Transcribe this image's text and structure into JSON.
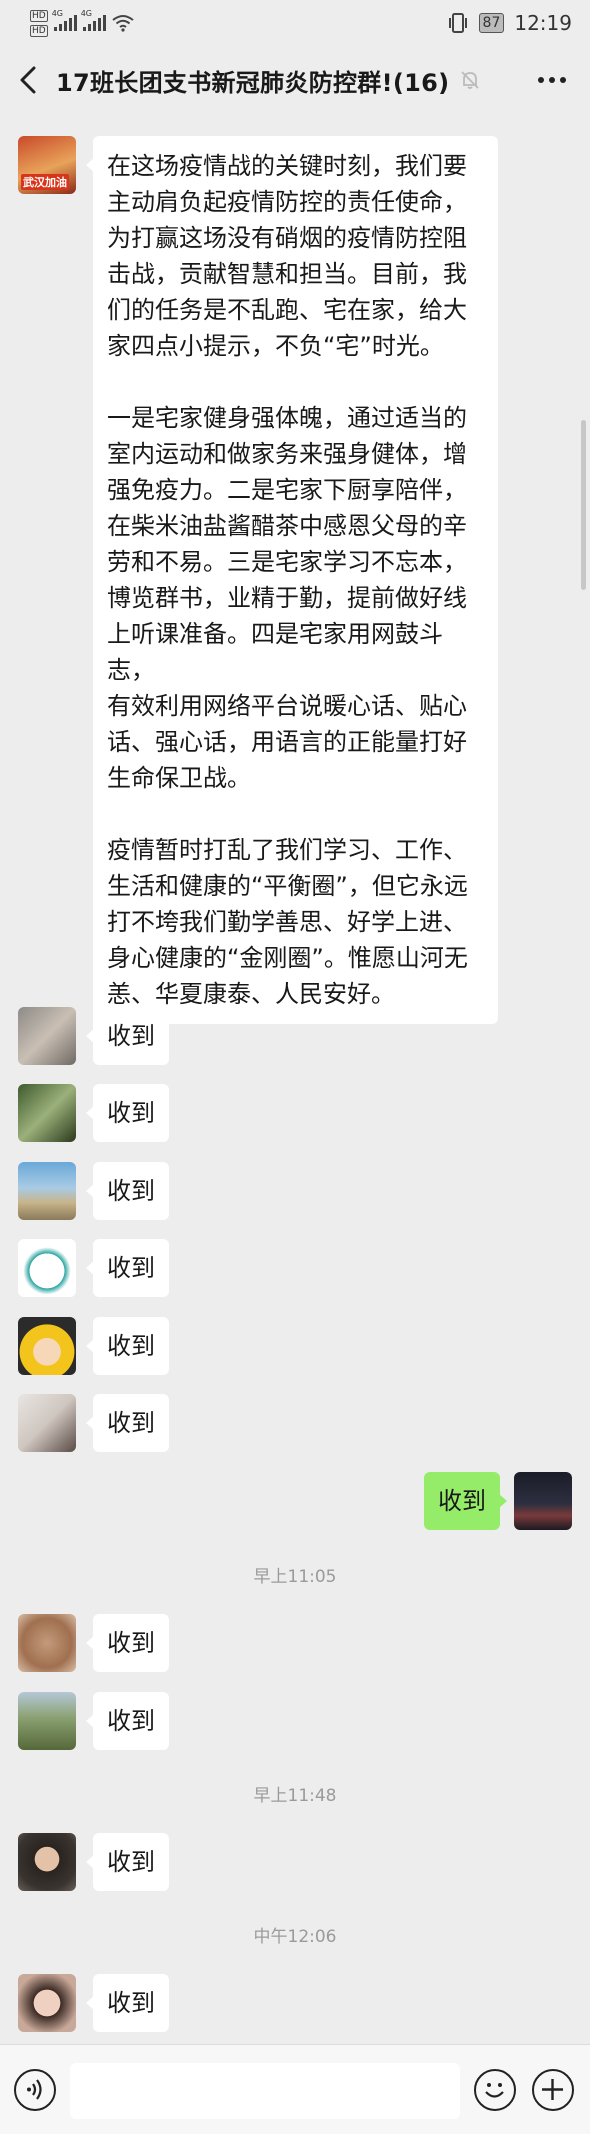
{
  "status_bar": {
    "net1": "4G",
    "net2": "4G",
    "hd": "HD",
    "battery": "87",
    "time": "12:19"
  },
  "header": {
    "title": "17班长团支书新冠肺炎防控群!(16)"
  },
  "first_message": {
    "avatar_text": "武汉加油",
    "paragraph1": [
      "在这场疫情战的关键时刻，我们要",
      "主动肩负起疫情防控的责任使命，",
      "为打赢这场没有硝烟的疫情防控阻",
      "击战，贡献智慧和担当。目前，我",
      "们的任务是不乱跑、宅在家，给大",
      "家四点小提示，不负“宅”时光。"
    ],
    "paragraph2": [
      "一是宅家健身强体魄，通过适当的",
      "室内运动和做家务来强身健体，增",
      "强免疫力。二是宅家下厨享陪伴，",
      "在柴米油盐酱醋茶中感恩父母的辛",
      "劳和不易。三是宅家学习不忘本，",
      "博览群书，业精于勤，提前做好线",
      "上听课准备。四是宅家用网鼓斗志，",
      "有效利用网络平台说暖心话、贴心",
      "话、强心话，用语言的正能量打好",
      "生命保卫战。"
    ],
    "paragraph3": [
      "疫情暂时打乱了我们学习、工作、",
      "生活和健康的“平衡圈”，但它永远",
      "打不垮我们勤学善思、好学上进、",
      "身心健康的“金刚圈”。惟愿山河无",
      "恙、华夏康泰、人民安好。"
    ]
  },
  "replies": {
    "r1": "收到",
    "r2": "收到",
    "r3": "收到",
    "r4": "收到",
    "r5": "收到",
    "r6": "收到",
    "me": "收到",
    "r7": "收到",
    "r8": "收到",
    "r9": "收到",
    "r10": "收到"
  },
  "timestamps": {
    "t1": "早上11:05",
    "t2": "早上11:48",
    "t3": "中午12:06"
  },
  "colors": {
    "background": "#ededed",
    "bubble_other": "#ffffff",
    "bubble_me": "#95ec69"
  }
}
